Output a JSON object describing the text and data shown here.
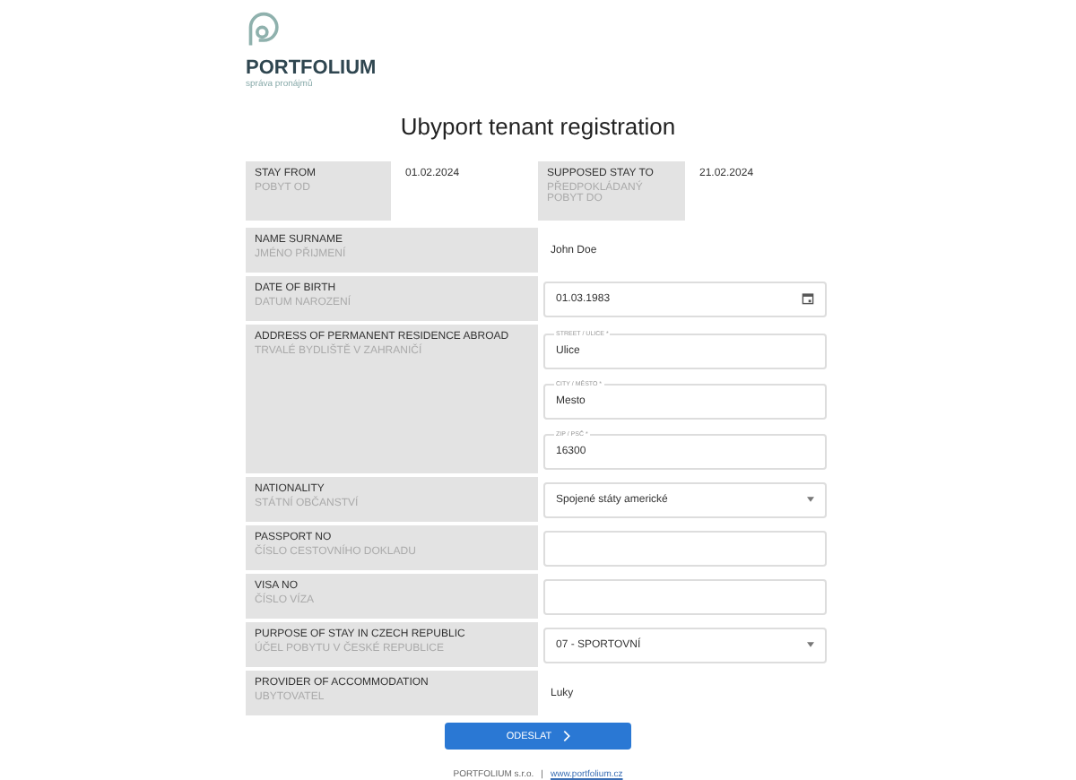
{
  "logo": {
    "name": "PORTFOLIUM",
    "tagline": "správa pronájmů"
  },
  "title": "Ubyport tenant registration",
  "stay": [
    {
      "label": "STAY FROM",
      "sublabel": "POBYT OD",
      "value": "01.02.2024"
    },
    {
      "label": "SUPPOSED STAY TO",
      "sublabel": "PŘEDPOKLÁDANÝ POBYT DO",
      "value": "21.02.2024"
    }
  ],
  "rows": [
    {
      "label": "NAME SURNAME",
      "sublabel": "JMÉNO PŘIJMENÍ",
      "kind": "text",
      "value": "John Doe"
    },
    {
      "label": "DATE OF BIRTH",
      "sublabel": "DATUM NAROZENÍ",
      "kind": "date",
      "value": "01.03.1983"
    },
    {
      "label": "ADDRESS OF PERMANENT RESIDENCE ABROAD",
      "sublabel": "TRVALÉ BYDLIŠTĚ V ZAHRANIČÍ",
      "kind": "address",
      "fields": [
        {
          "label": "STREET / ULICE *",
          "value": "Ulice"
        },
        {
          "label": "CITY / MĚSTO *",
          "value": "Mesto"
        },
        {
          "label": "ZIP / PSČ *",
          "value": "16300"
        }
      ]
    },
    {
      "label": "NATIONALITY",
      "sublabel": "STÁTNÍ OBČANSTVÍ",
      "kind": "select",
      "value": "Spojené státy americké"
    },
    {
      "label": "PASSPORT NO",
      "sublabel": "ČÍSLO CESTOVNÍHO DOKLADU",
      "kind": "input"
    },
    {
      "label": "VISA NO",
      "sublabel": "ČÍSLO VÍZA",
      "kind": "input"
    },
    {
      "label": "PURPOSE OF STAY IN CZECH REPUBLIC",
      "sublabel": "ÚČEL POBYTU V ČESKÉ REPUBLICE",
      "kind": "select",
      "value": "07 - SPORTOVNÍ"
    },
    {
      "label": "PROVIDER OF ACCOMMODATION",
      "sublabel": "UBYTOVATEL",
      "kind": "text",
      "value": "Luky"
    }
  ],
  "submit": "ODESLAT",
  "footer": {
    "company": "PORTFOLIUM s.r.o.",
    "separator": "|",
    "link": "www.portfolium.cz"
  }
}
